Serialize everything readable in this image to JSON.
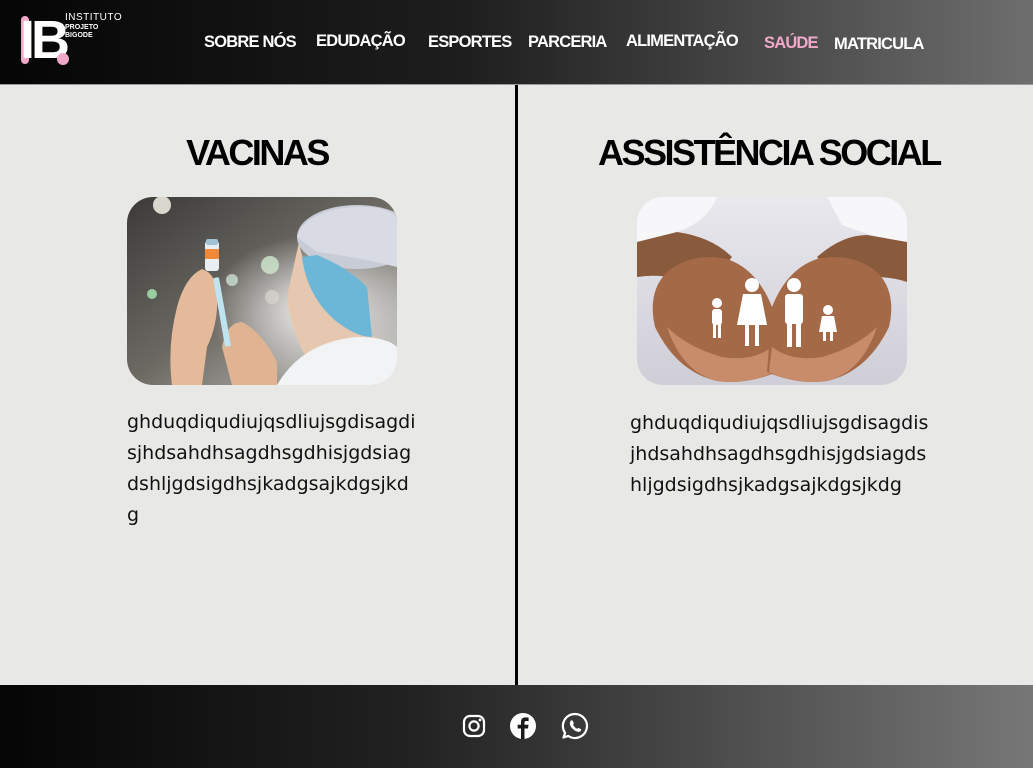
{
  "brand": {
    "logo_text": "IB",
    "line1": "INSTITUTO",
    "line2": "PROJETO",
    "line3": "BIGODE"
  },
  "nav": {
    "items": [
      {
        "label": "SOBRE NÓS"
      },
      {
        "label": "EDUDAÇÃO"
      },
      {
        "label": "ESPORTES"
      },
      {
        "label": "PARCERIA"
      },
      {
        "label": "ALIMENTAÇÃO"
      },
      {
        "label": "SAÚDE"
      },
      {
        "label": "MATRICULA"
      }
    ],
    "active": "SAÚDE"
  },
  "sections": {
    "left": {
      "title": "VACINAS",
      "text": "ghduqdiqudiujqsdliujsgdisagdisjhdsahdhsagdhsgdhisjgdsiagdshljgdsigdhsjkadgsajkdgsjkdg"
    },
    "right": {
      "title": "ASSISTÊNCIA SOCIAL",
      "text": "ghduqdiqudiujqsdliujsgdisagdisjhdsahdhsagdhsgdhisjgdsiagdshljgdsigdhsjkadgsajkdgsjkdg"
    }
  },
  "footer": {
    "icons": [
      "instagram-icon",
      "facebook-icon",
      "whatsapp-icon"
    ]
  },
  "colors": {
    "accent": "#f2a9c9",
    "background": "#e8e8e6",
    "header_dark": "#050505"
  }
}
